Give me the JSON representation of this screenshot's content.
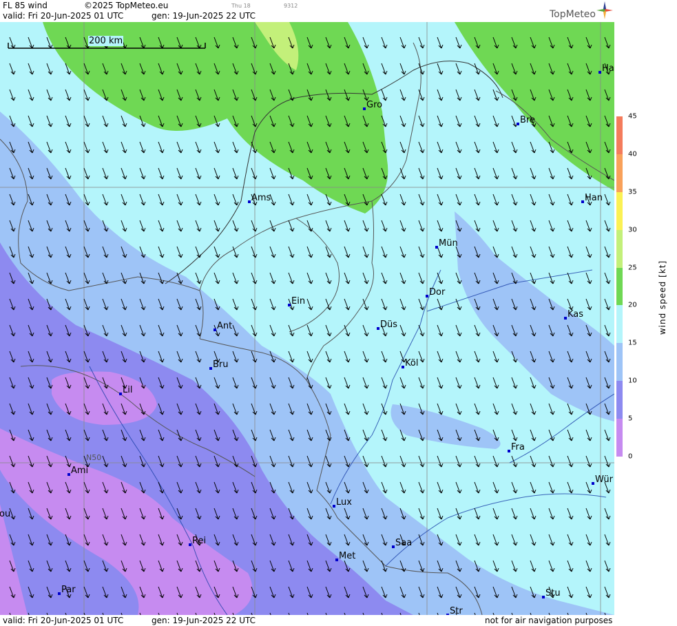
{
  "header": {
    "product": "FL 85 wind",
    "copyright": "©2025 TopMeteo.eu",
    "small_date": "Thu 18",
    "small_code": "9312",
    "valid": "valid:  Fri  20-Jun-2025  01 UTC",
    "generated": "gen: 19-Jun-2025 22 UTC",
    "brand": "TopMeteo"
  },
  "footer": {
    "valid": "valid:  Fri  20-Jun-2025  01 UTC",
    "generated": "gen: 19-Jun-2025 22 UTC",
    "disclaimer": "not for air navigation purposes"
  },
  "map": {
    "scale_label": "200 km",
    "lat_label": "N50",
    "cities": [
      {
        "label": "Ha",
        "name": "hamburg"
      },
      {
        "label": "Gro",
        "name": "groningen"
      },
      {
        "label": "Bre",
        "name": "bremen"
      },
      {
        "label": "Ams",
        "name": "amsterdam"
      },
      {
        "label": "Han",
        "name": "hannover"
      },
      {
        "label": "Mün",
        "name": "muenster"
      },
      {
        "label": "Ein",
        "name": "eindhoven"
      },
      {
        "label": "Dor",
        "name": "dortmund"
      },
      {
        "label": "Kas",
        "name": "kassel"
      },
      {
        "label": "Ant",
        "name": "antwerpen"
      },
      {
        "label": "Düs",
        "name": "duesseldorf"
      },
      {
        "label": "Bru",
        "name": "bruxelles"
      },
      {
        "label": "Köl",
        "name": "koeln"
      },
      {
        "label": "Lil",
        "name": "lille"
      },
      {
        "label": "Fra",
        "name": "frankfurt"
      },
      {
        "label": "Ami",
        "name": "amiens"
      },
      {
        "label": "Wür",
        "name": "wuerzburg"
      },
      {
        "label": "ou",
        "name": "rouen-partial"
      },
      {
        "label": "Lux",
        "name": "luxembourg"
      },
      {
        "label": "Rei",
        "name": "reims"
      },
      {
        "label": "Saa",
        "name": "saarbruecken"
      },
      {
        "label": "Met",
        "name": "metz"
      },
      {
        "label": "Par",
        "name": "paris"
      },
      {
        "label": "Stu",
        "name": "stuttgart"
      },
      {
        "label": "Str",
        "name": "strasbourg"
      }
    ]
  },
  "legend": {
    "title": "wind  speed  [kt]",
    "ticks": [
      "45",
      "40",
      "35",
      "30",
      "25",
      "20",
      "15",
      "10",
      "5",
      "0"
    ],
    "bands": [
      {
        "range": "40-45",
        "color": "#f47c5c"
      },
      {
        "range": "35-40",
        "color": "#f9a15a"
      },
      {
        "range": "30-35",
        "color": "#fbf154"
      },
      {
        "range": "25-30",
        "color": "#c3f07a"
      },
      {
        "range": "20-25",
        "color": "#6fd854"
      },
      {
        "range": "15-20",
        "color": "#b4f5fb"
      },
      {
        "range": "10-15",
        "color": "#9ec4f7"
      },
      {
        "range": "5-10",
        "color": "#8d8af0"
      },
      {
        "range": "0-5",
        "color": "#c68bf0"
      }
    ]
  }
}
